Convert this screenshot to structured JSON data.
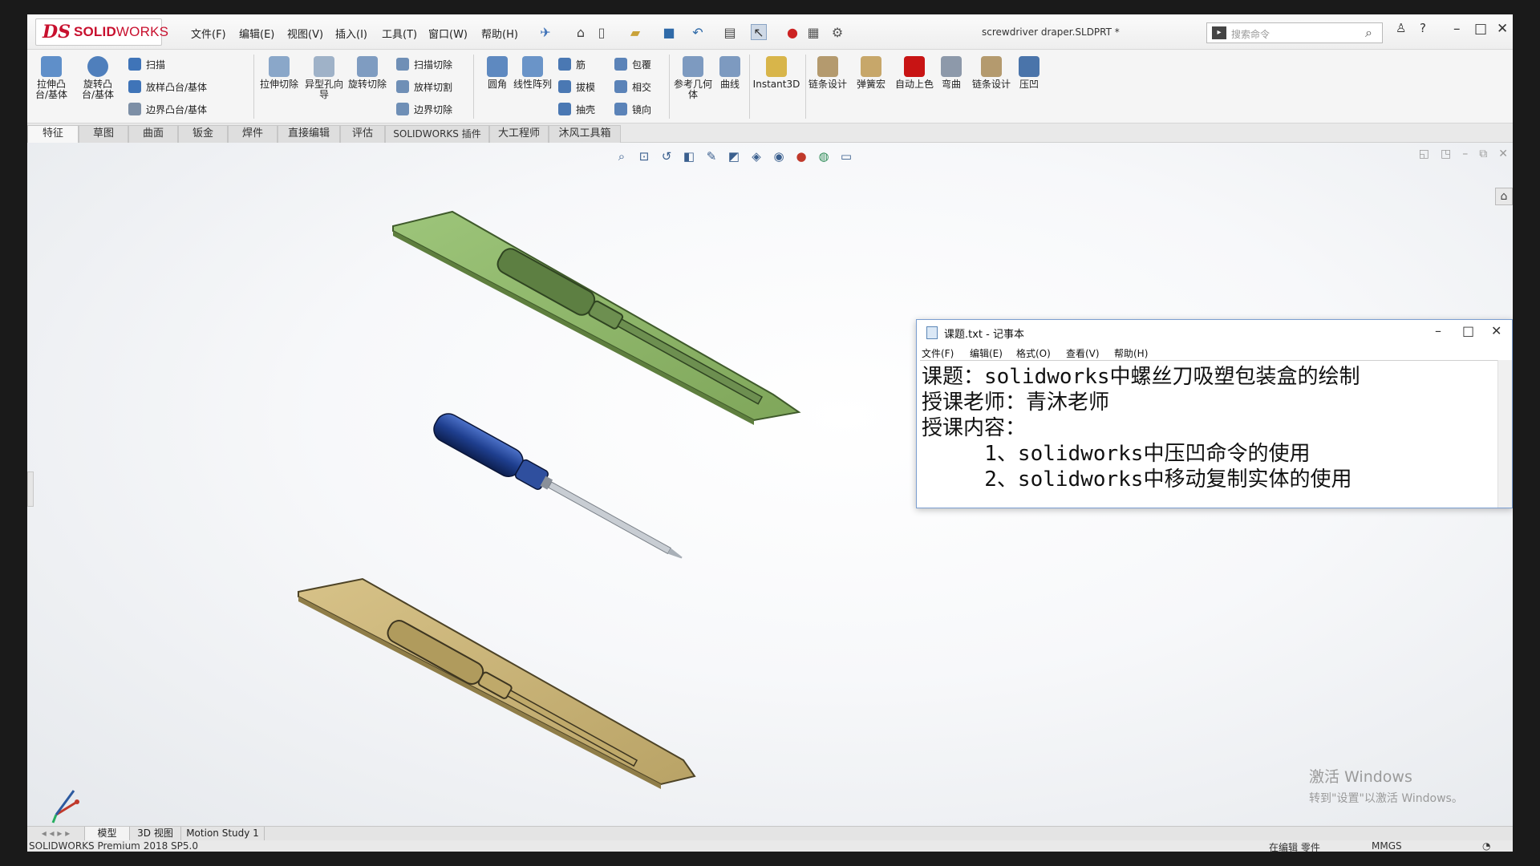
{
  "app": {
    "logo_ds": "DS",
    "logo_solid": "SOLID",
    "logo_works": "WORKS",
    "document_title": "screwdriver draper.SLDPRT *",
    "search_placeholder": "搜索命令",
    "edition": "SOLIDWORKS Premium 2018 SP5.0"
  },
  "menu": [
    "文件(F)",
    "编辑(E)",
    "视图(V)",
    "插入(I)",
    "工具(T)",
    "窗口(W)",
    "帮助(H)"
  ],
  "ribbon": {
    "extrude_boss": "拉伸凸台/基体",
    "revolve_boss": "旋转凸台/基体",
    "sweep": "扫描",
    "loft_boss": "放样凸台/基体",
    "boundary_boss": "边界凸台/基体",
    "extrude_cut": "拉伸切除",
    "hole_wizard": "异型孔向导",
    "revolve_cut": "旋转切除",
    "swept_cut": "扫描切除",
    "lofted_cut": "放样切割",
    "boundary_cut": "边界切除",
    "fillet": "圆角",
    "linear_pattern": "线性阵列",
    "rib": "筋",
    "draft": "拔模",
    "shell": "抽壳",
    "wrap": "包覆",
    "intersect": "相交",
    "mirror": "镜向",
    "ref_geometry": "参考几何体",
    "curves": "曲线",
    "instant3d": "Instant3D",
    "chain_design": "链条设计",
    "spring_macro": "弹簧宏",
    "auto_color": "自动上色",
    "bend": "弯曲",
    "chain_design2": "链条设计",
    "indent": "压凹"
  },
  "tabs": [
    "特征",
    "草图",
    "曲面",
    "钣金",
    "焊件",
    "直接编辑",
    "评估",
    "SOLIDWORKS 插件",
    "大工程师",
    "沐风工具箱"
  ],
  "notepad": {
    "title": "课题.txt - 记事本",
    "menu": [
      "文件(F)",
      "编辑(E)",
      "格式(O)",
      "查看(V)",
      "帮助(H)"
    ],
    "lines": [
      "课题：solidworks中螺丝刀吸塑包装盒的绘制",
      "授课老师：青沐老师",
      "授课内容：",
      "     1、solidworks中压凹命令的使用",
      "     2、solidworks中移动复制实体的使用"
    ]
  },
  "watermark": {
    "line1": "激活 Windows",
    "line2": "转到\"设置\"以激活 Windows。"
  },
  "bottom_tabs": [
    "模型",
    "3D 视图",
    "Motion Study 1"
  ],
  "status": {
    "edit_mode": "在编辑 零件",
    "units": "MMGS"
  },
  "colors": {
    "tray_top": "#8fb56a",
    "tray_bottom": "#c9b378",
    "handle": "#2a4a9a",
    "shaft": "#c8cdd3"
  }
}
